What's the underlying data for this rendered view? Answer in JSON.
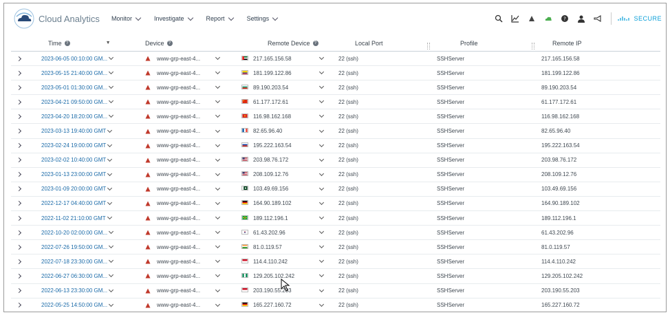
{
  "header": {
    "app_title": "Cloud Analytics",
    "nav": [
      {
        "label": "Monitor"
      },
      {
        "label": "Investigate"
      },
      {
        "label": "Report"
      },
      {
        "label": "Settings"
      }
    ],
    "notification_count": "",
    "brand": "SECURE",
    "icons": [
      "search-icon",
      "chart-icon",
      "alerts-icon",
      "cloud-icon",
      "help-icon",
      "user-icon",
      "megaphone-icon"
    ]
  },
  "table": {
    "columns": [
      {
        "label": "Time"
      },
      {
        "label": "Device"
      },
      {
        "label": "Remote Device"
      },
      {
        "label": "Local Port"
      },
      {
        "label": "Profile"
      },
      {
        "label": "Remote IP"
      }
    ],
    "rows": [
      {
        "time": "2023-06-05 00:10:00 GM...",
        "device": "www-grp-east-4...",
        "flag": "uae",
        "remote_device": "217.165.156.58",
        "port": "22 (ssh)",
        "profile": "SSHServer",
        "remote_ip": "217.165.156.58"
      },
      {
        "time": "2023-05-15 21:40:00 GM...",
        "device": "www-grp-east-4...",
        "flag": "ecuador",
        "remote_device": "181.199.122.86",
        "port": "22 (ssh)",
        "profile": "SSHServer",
        "remote_ip": "181.199.122.86"
      },
      {
        "time": "2023-05-01 01:30:00 GM...",
        "device": "www-grp-east-4...",
        "flag": "bulgaria",
        "remote_device": "89.190.203.54",
        "port": "22 (ssh)",
        "profile": "SSHServer",
        "remote_ip": "89.190.203.54"
      },
      {
        "time": "2023-04-21 09:50:00 GM...",
        "device": "www-grp-east-4...",
        "flag": "china",
        "remote_device": "61.177.172.61",
        "port": "22 (ssh)",
        "profile": "SSHServer",
        "remote_ip": "61.177.172.61"
      },
      {
        "time": "2023-04-20 18:20:00 GM...",
        "device": "www-grp-east-4...",
        "flag": "vietnam",
        "remote_device": "116.98.162.168",
        "port": "22 (ssh)",
        "profile": "SSHServer",
        "remote_ip": "116.98.162.168"
      },
      {
        "time": "2023-03-13 19:40:00 GMT",
        "device": "www-grp-east-4...",
        "flag": "france",
        "remote_device": "82.65.96.40",
        "port": "22 (ssh)",
        "profile": "SSHServer",
        "remote_ip": "82.65.96.40"
      },
      {
        "time": "2023-02-24 19:00:00 GMT",
        "device": "www-grp-east-4...",
        "flag": "russia",
        "remote_device": "195.222.163.54",
        "port": "22 (ssh)",
        "profile": "SSHServer",
        "remote_ip": "195.222.163.54"
      },
      {
        "time": "2023-02-02 10:40:00 GMT",
        "device": "www-grp-east-4...",
        "flag": "usa",
        "remote_device": "203.98.76.172",
        "port": "22 (ssh)",
        "profile": "SSHServer",
        "remote_ip": "203.98.76.172"
      },
      {
        "time": "2023-01-13 23:00:00 GMT",
        "device": "www-grp-east-4...",
        "flag": "usa",
        "remote_device": "208.109.12.76",
        "port": "22 (ssh)",
        "profile": "SSHServer",
        "remote_ip": "208.109.12.76"
      },
      {
        "time": "2023-01-09 20:00:00 GMT",
        "device": "www-grp-east-4...",
        "flag": "pakistan",
        "remote_device": "103.49.69.156",
        "port": "22 (ssh)",
        "profile": "SSHServer",
        "remote_ip": "103.49.69.156"
      },
      {
        "time": "2022-12-17 04:40:00 GMT",
        "device": "www-grp-east-4...",
        "flag": "germany",
        "remote_device": "164.90.189.102",
        "port": "22 (ssh)",
        "profile": "SSHServer",
        "remote_ip": "164.90.189.102"
      },
      {
        "time": "2022-11-02 21:10:00 GMT",
        "device": "www-grp-east-4...",
        "flag": "brazil",
        "remote_device": "189.112.196.1",
        "port": "22 (ssh)",
        "profile": "SSHServer",
        "remote_ip": "189.112.196.1"
      },
      {
        "time": "2022-10-20 02:00:00 GM...",
        "device": "www-grp-east-4...",
        "flag": "korea",
        "remote_device": "61.43.202.96",
        "port": "22 (ssh)",
        "profile": "SSHServer",
        "remote_ip": "61.43.202.96"
      },
      {
        "time": "2022-07-26 19:50:00 GM...",
        "device": "www-grp-east-4...",
        "flag": "india",
        "remote_device": "81.0.119.57",
        "port": "22 (ssh)",
        "profile": "SSHServer",
        "remote_ip": "81.0.119.57"
      },
      {
        "time": "2022-07-18 23:30:00 GM...",
        "device": "www-grp-east-4...",
        "flag": "indonesia",
        "remote_device": "114.4.110.242",
        "port": "22 (ssh)",
        "profile": "SSHServer",
        "remote_ip": "114.4.110.242"
      },
      {
        "time": "2022-06-27 06:30:00 GM...",
        "device": "www-grp-east-4...",
        "flag": "nigeria",
        "remote_device": "129.205.102.242",
        "port": "22 (ssh)",
        "profile": "SSHServer",
        "remote_ip": "129.205.102.242"
      },
      {
        "time": "2022-06-13 23:30:00 GM...",
        "device": "www-grp-east-4...",
        "flag": "indonesia",
        "remote_device": "203.190.55.203",
        "port": "22 (ssh)",
        "profile": "SSHServer",
        "remote_ip": "203.190.55.203"
      },
      {
        "time": "2022-05-25 14:50:00 GM...",
        "device": "www-grp-east-4...",
        "flag": "germany",
        "remote_device": "165.227.160.72",
        "port": "22 (ssh)",
        "profile": "SSHServer",
        "remote_ip": "165.227.160.72"
      }
    ]
  },
  "colors": {
    "accent": "#1a6aa8",
    "brand": "#0b9fd8",
    "alert": "#d0112b",
    "device_icon": "#c0392b"
  }
}
